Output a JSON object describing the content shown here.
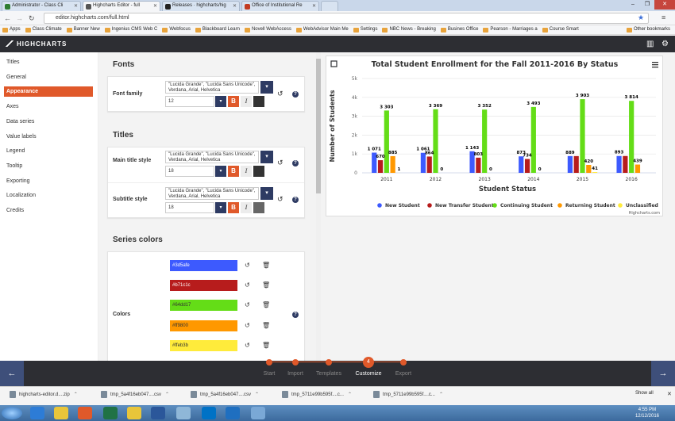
{
  "browser": {
    "tabs": [
      {
        "title": "Administrator - Class Cli",
        "favicon_color": "#2f7d32"
      },
      {
        "title": "Highcharts Editor - full",
        "favicon_color": "#555555"
      },
      {
        "title": "Releases · highcharts/hig",
        "favicon_color": "#222222"
      },
      {
        "title": "Office of Institutional Re",
        "favicon_color": "#c23b22"
      }
    ],
    "url": "editor.highcharts.com/full.html",
    "bookmarks": [
      "Apps",
      "Class Climate",
      "Banner New",
      "Ingenius CMS Web C",
      "Webfocus",
      "Blackboard Learn",
      "Novell WebAccess",
      "WebAdvisor Main Me",
      "Settings",
      "NBC News - Breaking",
      "Busines Office",
      "Pearson - Marriages a",
      "Course Smart"
    ],
    "other_bookmarks": "Other bookmarks"
  },
  "app": {
    "logo": "HIGHCHARTS"
  },
  "sidebar": {
    "items": [
      "Titles",
      "General",
      "Appearance",
      "Axes",
      "Data series",
      "Value labels",
      "Legend",
      "Tooltip",
      "Exporting",
      "Localization",
      "Credits"
    ],
    "active": "Appearance"
  },
  "fonts_section": {
    "heading": "Fonts",
    "label": "Font family",
    "font_value": "\"Lucida Grande\", \"Lucida Sans Unicode\", Verdana, Arial, Helvetica",
    "size": "12"
  },
  "titles_section": {
    "heading": "Titles",
    "main_label": "Main title style",
    "main_font": "\"Lucida Grande\", \"Lucida Sans Unicode\", Verdana, Arial, Helvetica",
    "main_size": "18",
    "sub_label": "Subtitle style",
    "sub_font": "\"Lucida Grande\", \"Lucida Sans Unicode\", Verdana, Arial, Helvetica",
    "sub_size": "18"
  },
  "series_colors": {
    "heading": "Series colors",
    "label": "Colors",
    "colors": [
      "#3d5afe",
      "#b71c1c",
      "#64dd17",
      "#ff9800",
      "#ffeb3b"
    ]
  },
  "chart_data": {
    "type": "bar",
    "title": "Total Student Enrollment for the Fall 2011-2016 By Status",
    "xlabel": "Student Status",
    "ylabel": "Number of Students",
    "categories": [
      "2011",
      "2012",
      "2013",
      "2014",
      "2015",
      "2016"
    ],
    "y_ticks": [
      "0",
      "1k",
      "2k",
      "3k",
      "4k",
      "5k"
    ],
    "ylim": [
      0,
      5000
    ],
    "series": [
      {
        "name": "New Student",
        "color": "#3d5afe",
        "values": [
          1071,
          1061,
          1143,
          873,
          889,
          893
        ],
        "labels": [
          "1 071",
          "1 061",
          "1 143",
          "873",
          "889",
          "893"
        ]
      },
      {
        "name": "New Transfer Student",
        "color": "#b71c1c",
        "values": [
          670,
          864,
          803,
          734,
          889,
          893
        ],
        "labels": [
          "670",
          "864",
          "803",
          "734",
          "",
          ""
        ]
      },
      {
        "name": "Continuing Student",
        "color": "#64dd17",
        "values": [
          3303,
          3369,
          3352,
          3493,
          3903,
          3814
        ],
        "labels": [
          "3 303",
          "3 369",
          "3 352",
          "3 493",
          "3 903",
          "3 814"
        ]
      },
      {
        "name": "Returning Student",
        "color": "#ff9800",
        "values": [
          885,
          0,
          0,
          0,
          420,
          439
        ],
        "labels": [
          "885",
          "0",
          "0",
          "0",
          "420",
          "439"
        ]
      },
      {
        "name": "Unclassified",
        "color": "#ffeb3b",
        "values": [
          1,
          0,
          0,
          0,
          41,
          0
        ],
        "labels": [
          "1",
          "",
          "",
          "",
          "41",
          ""
        ]
      }
    ],
    "credits": "Highcharts.com",
    "grid": true,
    "legend": "bottom"
  },
  "steps": {
    "items": [
      "Start",
      "Import",
      "Templates",
      "Customize",
      "Export"
    ],
    "active": "Customize",
    "active_number": "4"
  },
  "downloads": {
    "items": [
      "highcharts-editor.d....zip",
      "tmp_5a4f16eb047....csv",
      "tmp_5a4f16eb047....csv",
      "tmp_5711e99b595f....c...",
      "tmp_5711e99b595f....c..."
    ],
    "show_all": "Show all"
  },
  "taskbar": {
    "time": "4:55 PM",
    "date": "12/12/2016"
  }
}
